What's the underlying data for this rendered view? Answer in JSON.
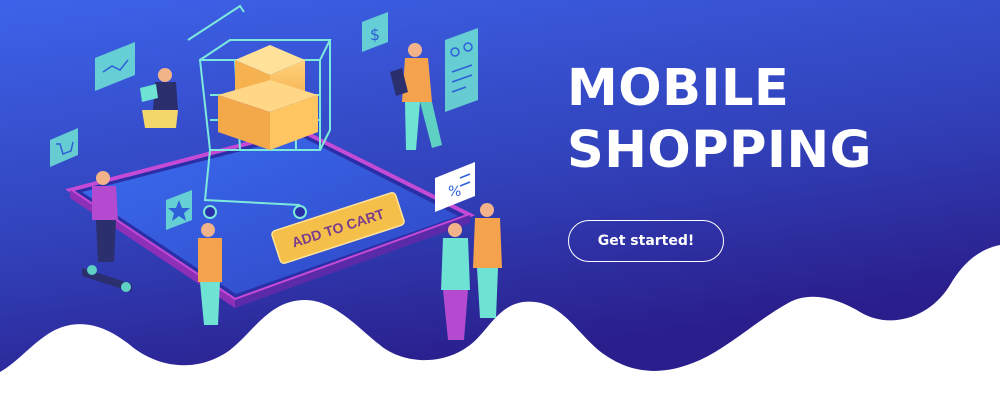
{
  "hero": {
    "title_line_1": "MOBILE",
    "title_line_2": "SHOPPING",
    "cta_label": "Get started!",
    "phone_button_label": "ADD TO CART"
  },
  "icons": [
    "dollar-sign-icon",
    "shopping-cart-icon",
    "star-icon",
    "percent-icon",
    "bicycle-icon",
    "chart-card-icon"
  ],
  "colors": {
    "background_top": "#3a5fe6",
    "background_bottom": "#2b1f8e",
    "phone_border": "#c54ad6",
    "add_to_cart_button": "#f5c04a",
    "card_teal": "#6fe3d3"
  }
}
